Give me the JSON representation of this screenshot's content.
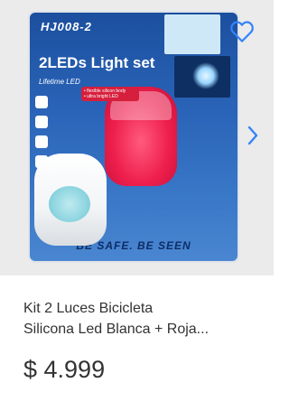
{
  "product": {
    "image_text": {
      "model": "HJ008-2",
      "headline": "2LEDs Light set",
      "tagline": "Lifetime LED",
      "feature_1": "• flexible silicon body",
      "feature_2": "• ultra bright LED",
      "slogan": "BE SAFE. BE SEEN"
    },
    "title_line_1": "Kit 2 Luces Bicicleta",
    "title_line_2": "Silicona Led Blanca + Roja...",
    "price": "$ 4.999"
  },
  "icons": {
    "favorite": "heart-outline-icon",
    "next": "chevron-right-icon"
  },
  "colors": {
    "accent": "#3483fa",
    "text": "#333333",
    "background": "#ebebeb"
  }
}
